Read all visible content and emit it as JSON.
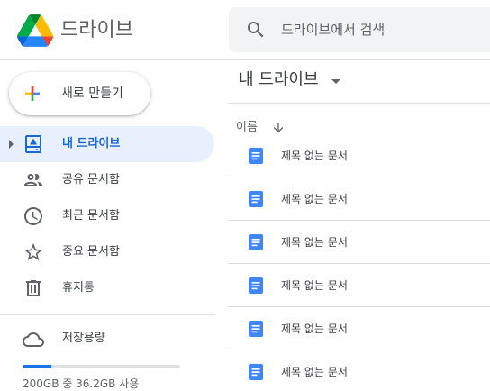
{
  "header": {
    "app_title": "드라이브",
    "logo_icon": "google-drive-logo",
    "search": {
      "placeholder": "드라이브에서 검색",
      "icon": "search-icon"
    }
  },
  "sidebar": {
    "new_button": {
      "label": "새로 만들기",
      "icon": "plus-icon"
    },
    "items": [
      {
        "label": "내 드라이브",
        "icon": "my-drive-icon",
        "active": true
      },
      {
        "label": "공유 문서함",
        "icon": "people-icon",
        "active": false
      },
      {
        "label": "최근 문서함",
        "icon": "clock-icon",
        "active": false
      },
      {
        "label": "중요 문서함",
        "icon": "star-icon",
        "active": false
      },
      {
        "label": "휴지통",
        "icon": "trash-icon",
        "active": false
      }
    ],
    "storage": {
      "label": "저장용량",
      "icon": "cloud-icon",
      "usage_text": "200GB 중 36.2GB 사용",
      "used_fraction": 0.181
    }
  },
  "main": {
    "title": "내 드라이브",
    "column_header": "이름",
    "sort_icon": "arrow-down-icon",
    "files": [
      {
        "name": "제목 없는 문서",
        "icon": "google-docs-icon"
      },
      {
        "name": "제목 없는 문서",
        "icon": "google-docs-icon"
      },
      {
        "name": "제목 없는 문서",
        "icon": "google-docs-icon"
      },
      {
        "name": "제목 없는 문서",
        "icon": "google-docs-icon"
      },
      {
        "name": "제목 없는 문서",
        "icon": "google-docs-icon"
      },
      {
        "name": "제목 없는 문서",
        "icon": "google-docs-icon"
      }
    ]
  },
  "colors": {
    "accent": "#1a73e8",
    "active_bg": "#e8f0fe",
    "active_text": "#1967d2",
    "docs_blue": "#4285f4",
    "divider": "#dadce0"
  }
}
